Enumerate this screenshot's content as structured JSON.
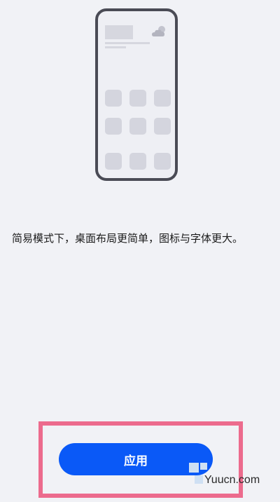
{
  "description": "简易模式下，桌面布局更简单，图标与字体更大。",
  "apply_button": {
    "label": "应用"
  },
  "preview": {
    "weather_icon": "partly-cloudy-icon",
    "app_icon_count": 9
  },
  "watermark": {
    "text": "Yuucn.com"
  },
  "colors": {
    "accent": "#0a59f7",
    "highlight": "#ec6b8d",
    "background": "#f1f2f6"
  }
}
